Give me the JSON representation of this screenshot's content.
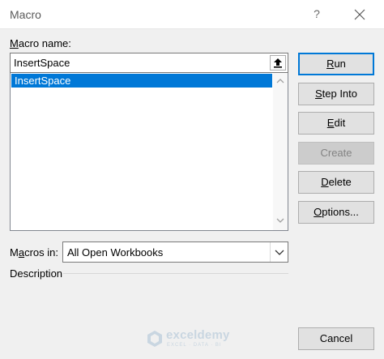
{
  "window": {
    "title": "Macro",
    "help_glyph": "?"
  },
  "macro_name": {
    "label_accel": "M",
    "label_rest": "acro name:",
    "value": "InsertSpace"
  },
  "macro_list": {
    "items": [
      {
        "label": "InsertSpace",
        "selected": true
      }
    ]
  },
  "buttons": {
    "run": {
      "accel": "R",
      "rest": "un"
    },
    "step_into": {
      "accel": "S",
      "rest": "tep Into"
    },
    "edit": {
      "accel": "E",
      "rest": "dit"
    },
    "create": {
      "label": "Create",
      "disabled": true
    },
    "delete": {
      "accel": "D",
      "rest": "elete"
    },
    "options": {
      "accel": "O",
      "rest": "ptions..."
    },
    "cancel": {
      "label": "Cancel"
    }
  },
  "macros_in": {
    "label_pre": "M",
    "label_accel": "a",
    "label_rest": "cros in:",
    "selected": "All Open Workbooks"
  },
  "description": {
    "label": "Description"
  },
  "watermark": {
    "name": "exceldemy",
    "tagline": "EXCEL · DATA · BI"
  },
  "colors": {
    "selection": "#0078d7",
    "background": "#f0f0f0"
  }
}
